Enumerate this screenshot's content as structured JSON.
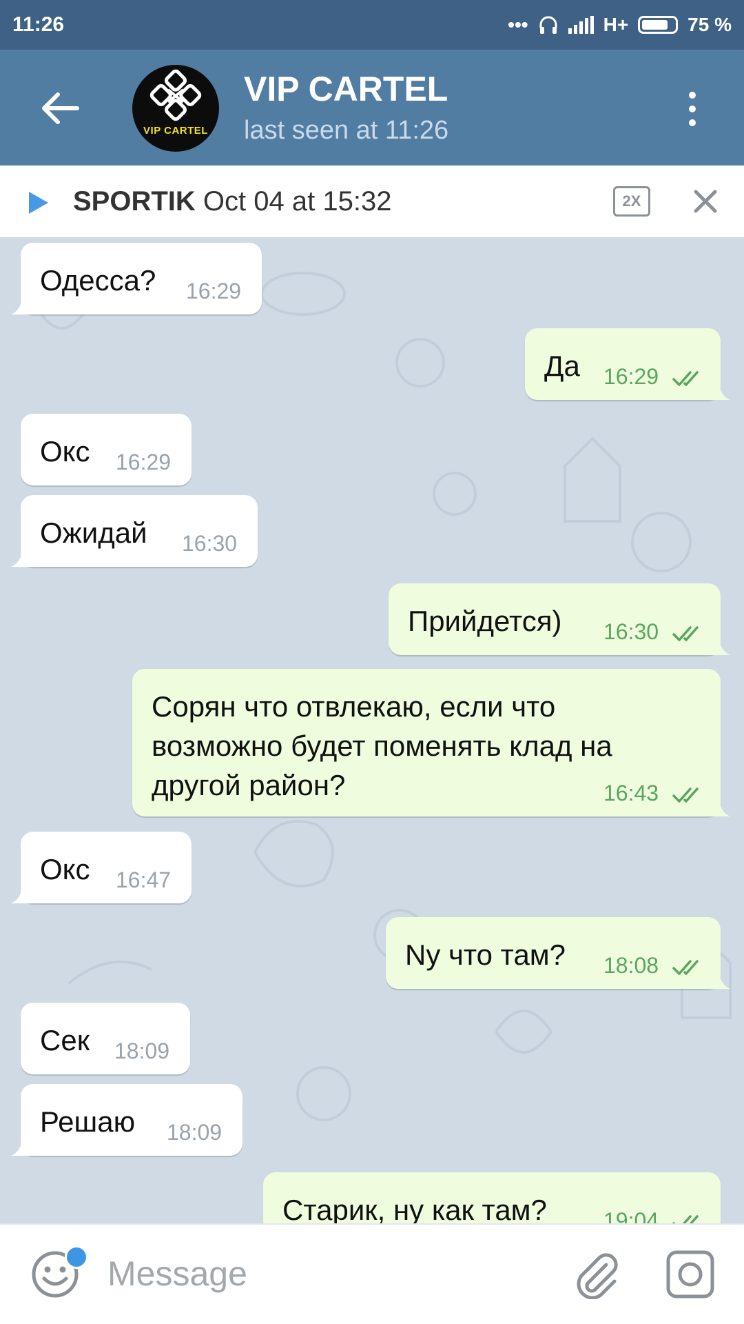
{
  "status_bar": {
    "time": "11:26",
    "network": "H+",
    "battery": "75 %",
    "icons": [
      "dots-icon",
      "headphones-icon",
      "signal-icon",
      "battery-icon"
    ]
  },
  "header": {
    "title": "VIP CARTEL",
    "subtitle": "last seen at 11:26",
    "avatar_text": "VIP CARTEL",
    "colors": {
      "status_bar": "#3f6185",
      "app_bar": "#527da3"
    }
  },
  "pinned": {
    "name": "SPORTIK",
    "date": "Oct 04 at 15:32",
    "speed": "2X"
  },
  "messages": [
    {
      "dir": "in",
      "text": "Одесса?",
      "time": "16:29"
    },
    {
      "dir": "out",
      "text": "Да",
      "time": "16:29"
    },
    {
      "dir": "in",
      "text": "Окс",
      "time": "16:29"
    },
    {
      "dir": "in",
      "text": "Ожидай",
      "time": "16:30"
    },
    {
      "dir": "out",
      "text": "Прийдется)",
      "time": "16:30"
    },
    {
      "dir": "out",
      "lines": [
        "Сорян что отвлекаю, если что",
        "возможно будет поменять клад на",
        "другой район?"
      ],
      "time": "16:43"
    },
    {
      "dir": "in",
      "text": "Окс",
      "time": "16:47"
    },
    {
      "dir": "out",
      "text": "Ny что там?",
      "time": "18:08"
    },
    {
      "dir": "in",
      "text": "Сек",
      "time": "18:09"
    },
    {
      "dir": "in",
      "text": "Решаю",
      "time": "18:09"
    },
    {
      "dir": "out",
      "text": "Старик, ну как там?",
      "time": "19:04"
    }
  ],
  "input": {
    "placeholder": "Message"
  }
}
